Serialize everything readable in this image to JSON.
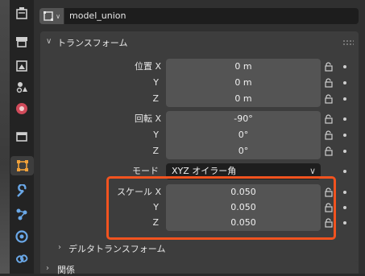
{
  "header": {
    "object_name": "model_union"
  },
  "transform": {
    "title": "トランスフォーム",
    "location": {
      "label": "位置 X",
      "y_label": "Y",
      "z_label": "Z",
      "x": "0 m",
      "y": "0 m",
      "z": "0 m"
    },
    "rotation": {
      "label": "回転 X",
      "y_label": "Y",
      "z_label": "Z",
      "x": "-90°",
      "y": "0°",
      "z": "0°"
    },
    "mode": {
      "label": "モード",
      "value": "XYZ オイラー角"
    },
    "scale": {
      "label": "スケール X",
      "y_label": "Y",
      "z_label": "Z",
      "x": "0.050",
      "y": "0.050",
      "z": "0.050"
    }
  },
  "delta_transform": {
    "title": "デルタトランスフォーム"
  },
  "relations": {
    "title": "関係"
  },
  "colors": {
    "highlight": "#f2531f",
    "active_tab": "#3d3d3d"
  },
  "icons": [
    "tool-icon",
    "render-icon",
    "output-icon",
    "view-layer-icon",
    "scene-icon",
    "world-icon",
    "object-icon",
    "modifier-icon",
    "particles-icon",
    "physics-icon",
    "constraints-icon"
  ]
}
